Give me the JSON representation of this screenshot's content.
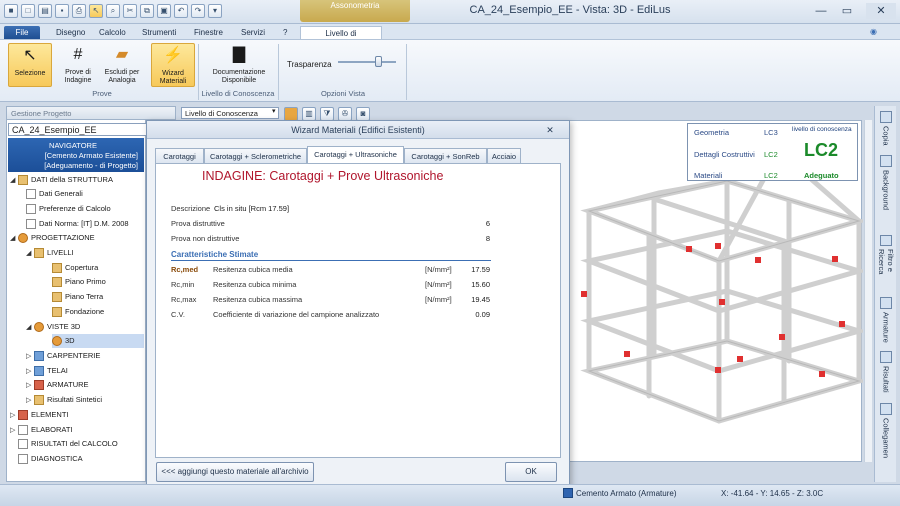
{
  "app": {
    "context_tab": "Assonometria",
    "window_title": "CA_24_Esempio_EE  -  Vista: 3D  -  EdiLus"
  },
  "menu": {
    "file": "File",
    "disegno": "Disegno",
    "calcolo": "Calcolo",
    "strumenti": "Strumenti",
    "finestre": "Finestre",
    "servizi": "Servizi",
    "help": "?",
    "livello": "Livello di conoscenza"
  },
  "ribbon": {
    "selezione": "Selezione",
    "prove_indagine": "Prove di Indagine",
    "escludi": "Escludi per Analogia",
    "wizard": "Wizard Materiali",
    "group_prove": "Prove",
    "documentazione": "Documentazione Disponibile",
    "group_livello": "Livello di Conoscenza",
    "trasparenza": "Trasparenza",
    "group_opzioni": "Opzioni Vista"
  },
  "left": {
    "panel_title": "Gestione Progetto",
    "project": "CA_24_Esempio_EE",
    "navigator_l1": "NAVIGATORE",
    "navigator_l2": "[Cemento Armato Esistente]",
    "navigator_l3": "[Adeguamento - di Progetto]",
    "tree": {
      "dati_struttura": "DATI della STRUTTURA",
      "dati_generali": "Dati Generali",
      "preferenze": "Preferenze di Calcolo",
      "dati_norma": "Dati Norma: [IT] D.M. 2008",
      "progettazione": "PROGETTAZIONE",
      "livelli": "LIVELLI",
      "copertura": "Copertura",
      "piano_primo": "Piano Primo",
      "piano_terra": "Piano Terra",
      "fondazione": "Fondazione",
      "viste3d": "VISTE 3D",
      "v3d": "3D",
      "carpenterie": "CARPENTERIE",
      "telai": "TELAI",
      "armature": "ARMATURE",
      "risultati_sintetici": "Risultati Sintetici",
      "elementi": "ELEMENTI",
      "elaborati": "ELABORATI",
      "risultati_calcolo": "RISULTATI del CALCOLO",
      "diagnostica": "DIAGNOSTICA"
    }
  },
  "toolbar": {
    "livello_select": "Livello di Conoscenza"
  },
  "infobox": {
    "geometria": "Geometria",
    "geometria_val": "LC3",
    "dettagli": "Dettagli Costruttivi",
    "dettagli_val": "LC2",
    "materiali": "Materiali",
    "materiali_val": "LC2",
    "livello_label": "livello di conoscenza",
    "livello_val": "LC2",
    "esito": "Adeguato"
  },
  "sidetabs": {
    "copia": "Copia",
    "background": "Background",
    "filtro": "Filtro e Ricerca",
    "armature": "Armature",
    "risultati": "Risultati",
    "collegamenti": "Collegamen"
  },
  "dialog": {
    "title": "Wizard Materiali (Edifici Esistenti)",
    "tabs": [
      "Carotaggi",
      "Carotaggi + Sclerometriche",
      "Carotaggi + Ultrasoniche",
      "Carotaggi + SonReb",
      "Acciaio"
    ],
    "heading": "INDAGINE: Carotaggi + Prove Ultrasoniche",
    "descrizione_label": "Descrizione",
    "descrizione_val": "Cls in situ [Rcm 17.59]",
    "prova_distruttive": "Prova distruttive",
    "prova_distruttive_val": "6",
    "prova_non_distruttive": "Prova non distruttive",
    "prova_non_distruttive_val": "8",
    "caratteristiche": "Caratteristiche Stimate",
    "rows": [
      {
        "sym": "Rc,med",
        "desc": "Resitenza cubica media",
        "unit": "[N/mm²]",
        "val": "17.59"
      },
      {
        "sym": "Rc,min",
        "desc": "Resitenza cubica minima",
        "unit": "[N/mm²]",
        "val": "15.60"
      },
      {
        "sym": "Rc,max",
        "desc": "Resitenza cubica massima",
        "unit": "[N/mm²]",
        "val": "19.45"
      },
      {
        "sym": "C.V.",
        "desc": "Coefficiente di variazione del campione analizzato",
        "unit": "",
        "val": "0.09"
      }
    ],
    "archive_button": "<<< aggiungi questo materiale all'archivio",
    "ok_button": "OK"
  },
  "status": {
    "material": "Cemento Armato (Armature)",
    "coords": "X: -41.64 - Y: 14.65 - Z: 3.0C"
  }
}
